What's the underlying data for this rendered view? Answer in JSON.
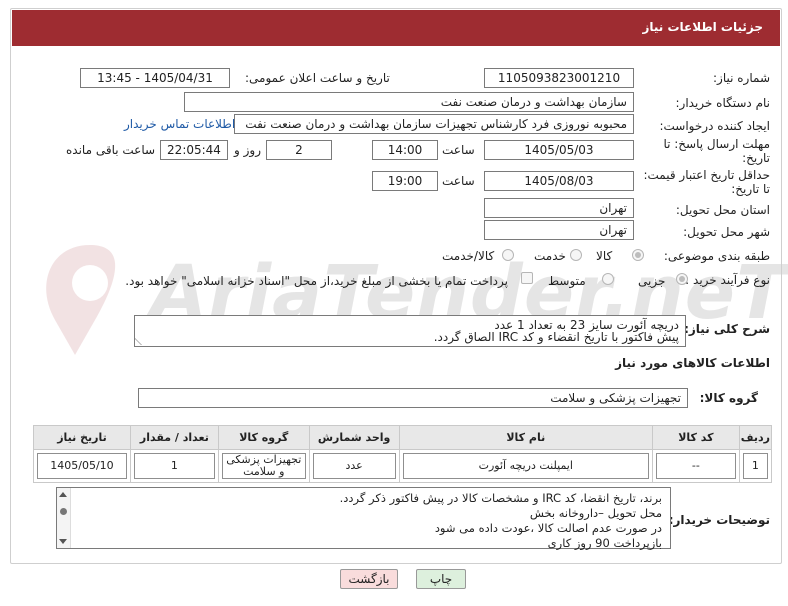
{
  "header": {
    "title": "جزئیات اطلاعات نیاز"
  },
  "watermark": {
    "text": "AriaTender.neT"
  },
  "form": {
    "need_number_label": "شماره نیاز:",
    "need_number": "1105093823001210",
    "announce_label": "تاریخ و ساعت اعلان عمومی:",
    "announce_value": "1405/04/31 - 13:45",
    "buyer_org_label": "نام دستگاه خریدار:",
    "buyer_org": "سازمان بهداشت و درمان صنعت نفت",
    "creator_label": "ایجاد کننده درخواست:",
    "creator": "محبوبه نوروزی فرد کارشناس تجهیزات سازمان بهداشت و درمان صنعت نفت",
    "contact_link": "اطلاعات تماس خریدار",
    "deadline_label_1": "مهلت ارسال پاسخ: تا",
    "deadline_label_2": "تاریخ:",
    "deadline_date": "1405/05/03",
    "time_label": "ساعت",
    "deadline_time": "14:00",
    "days_count": "2",
    "day_and": "روز و",
    "remaining": "22:05:44",
    "remaining_label": "ساعت باقی مانده",
    "min_price_label_1": "حداقل تاریخ اعتبار قیمت:",
    "min_price_label_2": "تا تاریخ:",
    "min_price_date": "1405/08/03",
    "min_price_time": "19:00",
    "province_label": "استان محل تحویل:",
    "province": "تهران",
    "city_label": "شهر محل تحویل:",
    "city": "تهران",
    "category_label": "طبقه بندی موضوعی:",
    "cat_goods": "کالا",
    "cat_service": "خدمت",
    "cat_goods_service": "کالا/خدمت",
    "process_label": "نوع فرآیند خرید :",
    "proc_partial": "جزیی",
    "proc_medium": "متوسط",
    "payment_note": "پرداخت تمام یا بخشی از مبلغ خرید،از محل \"اسناد خزانه اسلامی\" خواهد بود."
  },
  "description": {
    "label": "شرح کلی نیاز:",
    "line1": "دریچه آئورت سایز 23 به تعداد 1 عدد",
    "line2": "پیش فاکتور با تاریخ انقضاء و کد  IRC الصاق گردد."
  },
  "goods_info": {
    "title": "اطلاعات کالاهای مورد نیاز",
    "group_label": "گروه کالا:",
    "group_value": "تجهیزات پزشکی و سلامت"
  },
  "table": {
    "headers": [
      "ردیف",
      "کد کالا",
      "نام کالا",
      "واحد شمارش",
      "گروه کالا",
      "تعداد / مقدار",
      "تاریخ نیاز"
    ],
    "rows": [
      {
        "row": "1",
        "code": "--",
        "name": "ایمپلنت دریچه آئورت",
        "unit": "عدد",
        "group": "تجهیزات پزشکی و سلامت",
        "qty": "1",
        "date": "1405/05/10"
      }
    ]
  },
  "buyer_notes": {
    "label": "توضیحات خریدار:",
    "line1": "برند،  تاریخ انقضا، کد  IRC  و مشخصات کالا در پیش فاکتور ذکر گردد.",
    "line2": "محل تحویل –داروخانه بخش",
    "line3": "در صورت عدم اصالت کالا ،عودت داده می شود",
    "line4": "بازپرداخت 90 روز کاری"
  },
  "buttons": {
    "print": "چاپ",
    "back": "بازگشت"
  },
  "colors": {
    "header_bg": "#9e2c31",
    "link": "#1f5aa6",
    "back_bg": "#f9dcdc",
    "print_bg": "#ddf0dd"
  }
}
